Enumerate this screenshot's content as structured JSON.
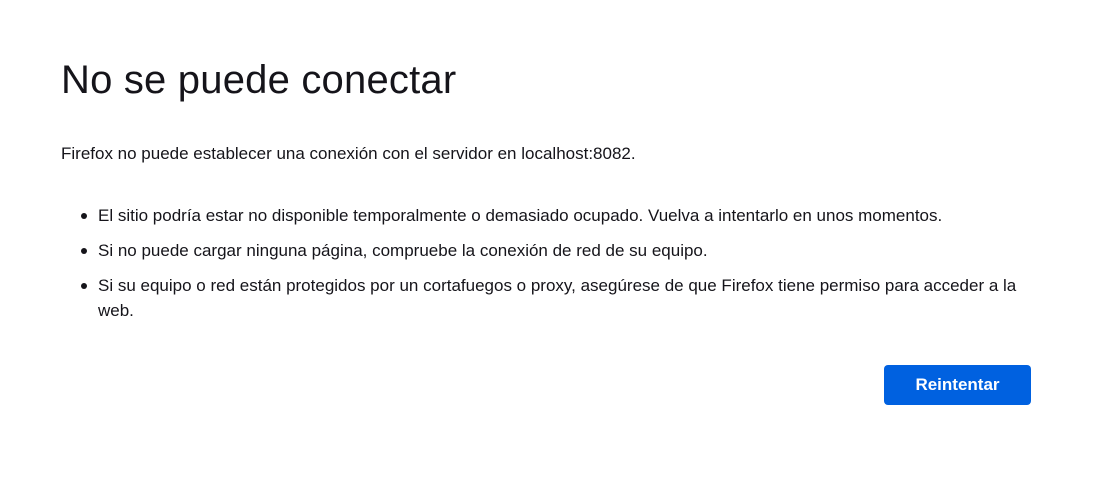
{
  "error": {
    "title": "No se puede conectar",
    "intro": "Firefox no puede establecer una conexión con el servidor en localhost:8082.",
    "suggestions": [
      "El sitio podría estar no disponible temporalmente o demasiado ocupado. Vuelva a intentarlo en unos momentos.",
      "Si no puede cargar ninguna página, compruebe la conexión de red de su equipo.",
      "Si su equipo o red están protegidos por un cortafuegos o proxy, asegúrese de que Firefox tiene permiso para acceder a la web."
    ],
    "retry_label": "Reintentar"
  },
  "colors": {
    "primary_button": "#0061e0",
    "text": "#15141a",
    "background": "#ffffff"
  }
}
